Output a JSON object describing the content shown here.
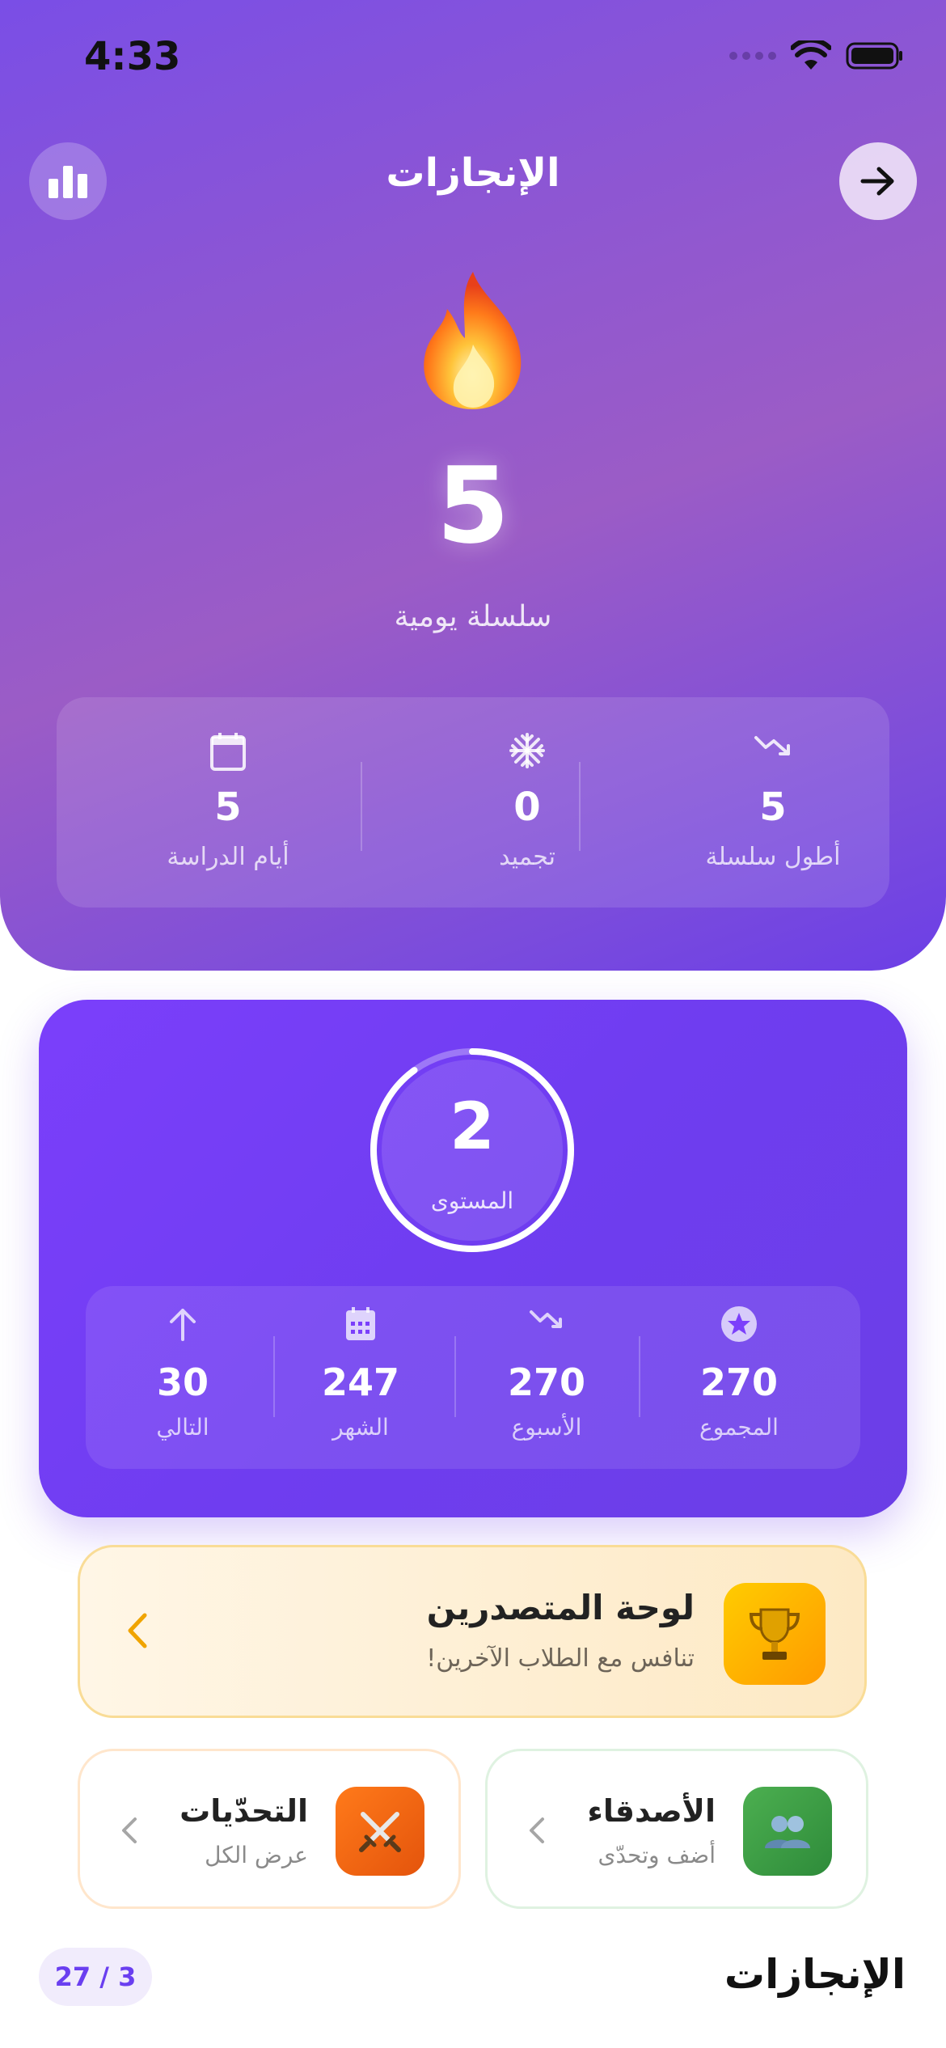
{
  "status_bar": {
    "time": "4:33"
  },
  "header": {
    "title": "الإنجازات"
  },
  "streak": {
    "value": "5",
    "label": "سلسلة يومية",
    "stats": [
      {
        "icon": "trending-icon",
        "value": "5",
        "label": "أطول سلسلة"
      },
      {
        "icon": "snowflake-icon",
        "value": "0",
        "label": "تجميد"
      },
      {
        "icon": "calendar-icon",
        "value": "5",
        "label": "أيام الدراسة"
      }
    ]
  },
  "level": {
    "value": "2",
    "label": "المستوى",
    "progress": 0.9,
    "stats": [
      {
        "icon": "star-icon",
        "value": "270",
        "label": "المجموع"
      },
      {
        "icon": "trending-icon",
        "value": "270",
        "label": "الأسبوع"
      },
      {
        "icon": "calendar-icon",
        "value": "247",
        "label": "الشهر"
      },
      {
        "icon": "arrow-up-icon",
        "value": "30",
        "label": "التالي"
      }
    ]
  },
  "leaderboard": {
    "title": "لوحة المتصدرين",
    "subtitle": "تنافس مع الطلاب الآخرين!",
    "icon": "trophy-icon"
  },
  "friends": {
    "title": "الأصدقاء",
    "subtitle": "أضف وتحدّى",
    "icon": "people-icon"
  },
  "challenges": {
    "title": "التحدّيات",
    "subtitle": "عرض الكل",
    "icon": "crossed-swords-icon"
  },
  "achievements": {
    "title": "الإنجازات",
    "count": "27 / 3"
  },
  "colors": {
    "accent": "#7b3ffb",
    "gold": "#ff9a00",
    "green": "#3ea84a",
    "orange": "#f06a10"
  }
}
